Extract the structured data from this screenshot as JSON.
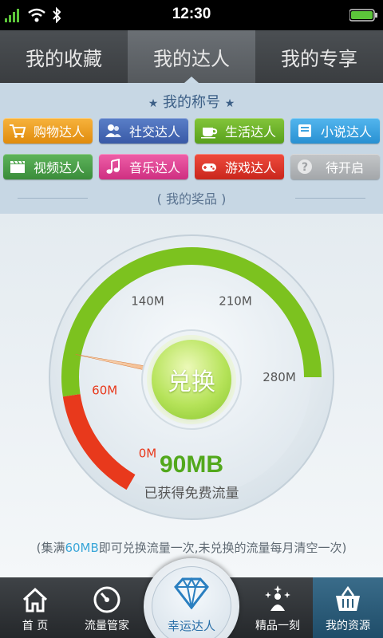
{
  "status_bar": {
    "time": "12:30"
  },
  "tabs": [
    {
      "label": "我的收藏",
      "active": false
    },
    {
      "label": "我的达人",
      "active": true
    },
    {
      "label": "我的专享",
      "active": false
    }
  ],
  "titles_section": {
    "heading": "我的称号",
    "badges": [
      {
        "label": "购物达人",
        "icon": "cart-icon",
        "color": "#f0a126"
      },
      {
        "label": "社交达人",
        "icon": "people-icon",
        "color": "#4a6fba"
      },
      {
        "label": "生活达人",
        "icon": "cup-icon",
        "color": "#6fb52b"
      },
      {
        "label": "小说达人",
        "icon": "book-icon",
        "color": "#3ea3e0"
      },
      {
        "label": "视频达人",
        "icon": "clapper-icon",
        "color": "#4ca24a"
      },
      {
        "label": "音乐达人",
        "icon": "music-note-icon",
        "color": "#e04695"
      },
      {
        "label": "游戏达人",
        "icon": "gamepad-icon",
        "color": "#dd372b"
      },
      {
        "label": "待开启",
        "icon": "question-icon",
        "color": "#b4b7ba"
      }
    ]
  },
  "prize_section": {
    "heading": "( 我的奖品 )"
  },
  "gauge": {
    "ticks": [
      "0M",
      "60M",
      "140M",
      "210M",
      "280M"
    ],
    "max_value_mb": 280,
    "current_value_mb": 90,
    "value_label": "90MB",
    "value_caption": "已获得免费流量",
    "exchange_label": "兑换",
    "colors": {
      "low": "#e8391c",
      "normal": "#7cc21f"
    }
  },
  "note": {
    "prefix": "(集满",
    "highlight": "60MB",
    "suffix": "即可兑换流量一次,未兑换的流量每月清空一次)"
  },
  "bottom_nav": [
    {
      "label": "首 页",
      "icon": "home-icon",
      "active": false
    },
    {
      "label": "流量管家",
      "icon": "dial-icon",
      "active": false
    },
    {
      "label": "幸运达人",
      "icon": "diamond-icon",
      "active": false
    },
    {
      "label": "精品一刻",
      "icon": "sparkle-person-icon",
      "active": false
    },
    {
      "label": "我的资源",
      "icon": "basket-icon",
      "active": true
    }
  ]
}
